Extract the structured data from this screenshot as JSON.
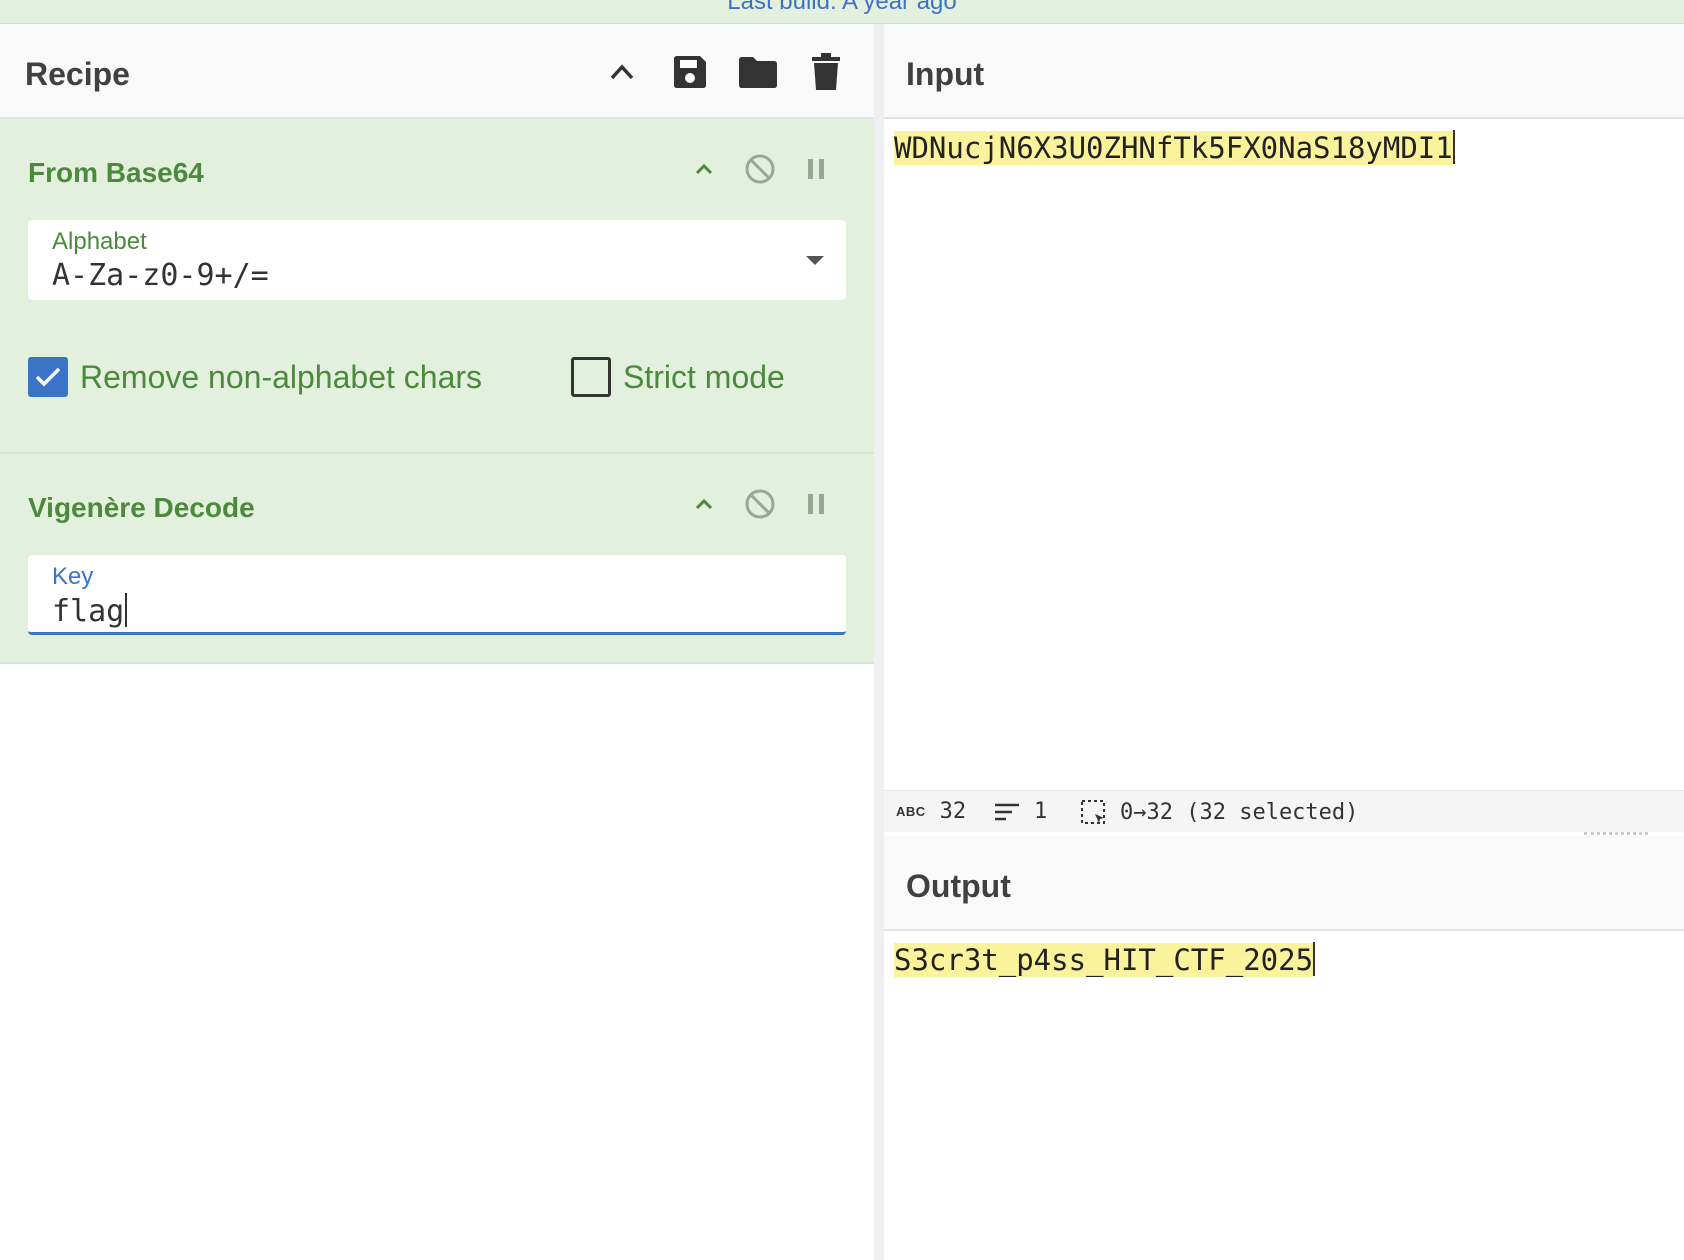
{
  "topbar": {
    "build_text": "Last build: A year ago"
  },
  "recipe": {
    "title": "Recipe",
    "header_icons": [
      "chevron-up-icon",
      "save-icon",
      "folder-icon",
      "trash-icon"
    ],
    "operations": [
      {
        "name": "From Base64",
        "alphabet_label": "Alphabet",
        "alphabet_value": "A-Za-z0-9+/=",
        "remove_non_alphabet": {
          "label": "Remove non-alphabet chars",
          "checked": true
        },
        "strict_mode": {
          "label": "Strict mode",
          "checked": false
        }
      },
      {
        "name": "Vigenère Decode",
        "key_label": "Key",
        "key_value": "flag"
      }
    ]
  },
  "input": {
    "title": "Input",
    "text": "WDNucjN6X3U0ZHNfTk5FX0NaS18yMDI1"
  },
  "status": {
    "length": "32",
    "lines": "1",
    "selection": "0→32 (32 selected)"
  },
  "output": {
    "title": "Output",
    "text": "S3cr3t_p4ss_HIT_CTF_2025"
  },
  "colors": {
    "operation_bg": "#e4f0de",
    "operation_text": "#4b8a3c",
    "accent_blue": "#3b73c8",
    "highlight": "#fbf39c"
  }
}
